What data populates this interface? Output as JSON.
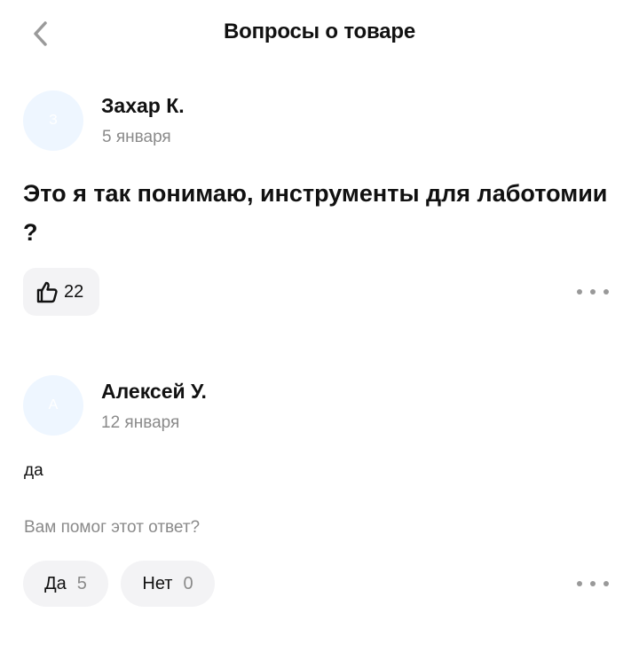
{
  "header": {
    "title": "Вопросы о товаре",
    "back_icon": "chevron-left-icon"
  },
  "question": {
    "author": "Захар К.",
    "avatar_letter": "З",
    "date": "5 января",
    "text": "Это я так понимаю, инструменты для лаботомии ?",
    "likes": "22",
    "like_icon": "thumbs-up-icon"
  },
  "answer": {
    "author": "Алексей У.",
    "avatar_letter": "А",
    "date": "12 января",
    "text": "да",
    "helpful_prompt": "Вам помог этот ответ?",
    "yes_label": "Да",
    "yes_count": "5",
    "no_label": "Нет",
    "no_count": "0"
  },
  "colors": {
    "avatar_bg": "#eef6ff",
    "muted_text": "#8a8a8a",
    "chip_bg": "#f3f3f5"
  }
}
